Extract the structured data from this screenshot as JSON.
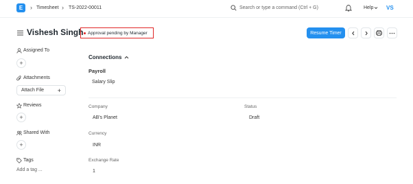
{
  "navbar": {
    "logo_letter": "E",
    "breadcrumbs": [
      "Timesheet",
      "TS-2022-00011"
    ],
    "search_placeholder": "Search or type a command (Ctrl + G)",
    "help_label": "Help",
    "avatar_initials": "VS"
  },
  "page": {
    "title": "Vishesh Singh",
    "status_indicator": "Approval pending by Manager",
    "primary_action": "Resume Timer"
  },
  "sidebar": {
    "assigned_to": "Assigned To",
    "attachments": "Attachments",
    "attach_file": "Attach File",
    "reviews": "Reviews",
    "shared_with": "Shared With",
    "tags": "Tags",
    "add_tag": "Add a tag ..."
  },
  "main": {
    "connections_label": "Connections",
    "group_title": "Payroll",
    "group_link": "Salary Slip",
    "fields": {
      "company_label": "Company",
      "company_value": "AB's Planet",
      "status_label": "Status",
      "status_value": "Draft",
      "currency_label": "Currency",
      "currency_value": "INR",
      "exchange_rate_label": "Exchange Rate",
      "exchange_rate_value": "1"
    }
  },
  "colors": {
    "accent": "#2490ef",
    "highlight_border": "#e02424"
  }
}
